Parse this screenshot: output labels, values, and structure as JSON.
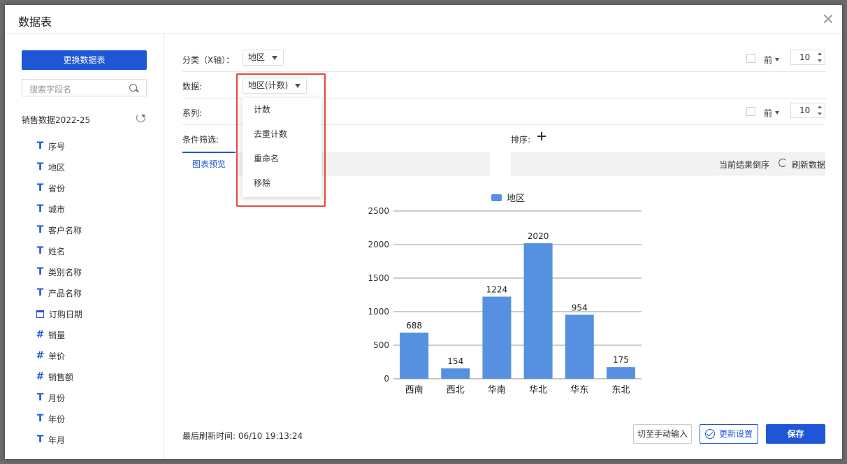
{
  "dialog": {
    "title": "数据表"
  },
  "sidebar": {
    "change_button": "更换数据表",
    "search_placeholder": "搜索字段名",
    "dataset_name": "销售数据2022-25",
    "fields": [
      {
        "type": "text",
        "icon": "text-type-icon",
        "label": "序号"
      },
      {
        "type": "text",
        "icon": "text-type-icon",
        "label": "地区"
      },
      {
        "type": "text",
        "icon": "text-type-icon",
        "label": "省份"
      },
      {
        "type": "text",
        "icon": "text-type-icon",
        "label": "城市"
      },
      {
        "type": "text",
        "icon": "text-type-icon",
        "label": "客户名称"
      },
      {
        "type": "text",
        "icon": "text-type-icon",
        "label": "姓名"
      },
      {
        "type": "text",
        "icon": "text-type-icon",
        "label": "类别名称"
      },
      {
        "type": "text",
        "icon": "text-type-icon",
        "label": "产品名称"
      },
      {
        "type": "date",
        "icon": "calendar-icon",
        "label": "订购日期"
      },
      {
        "type": "number",
        "icon": "hash-icon",
        "label": "销量"
      },
      {
        "type": "number",
        "icon": "hash-icon",
        "label": "单价"
      },
      {
        "type": "number",
        "icon": "hash-icon",
        "label": "销售额"
      },
      {
        "type": "text",
        "icon": "text-type-icon",
        "label": "月份"
      },
      {
        "type": "text",
        "icon": "text-type-icon",
        "label": "年份"
      },
      {
        "type": "text",
        "icon": "text-type-icon",
        "label": "年月"
      }
    ]
  },
  "config": {
    "category_label": "分类（X轴）：",
    "category_value": "地区",
    "data_label": "数据:",
    "data_value": "地区(计数)",
    "series_label": "系列:",
    "filter_label": "条件筛选:",
    "sort_label": "排序:",
    "top_label": "前",
    "top_value_1": "10",
    "top_value_2": "10"
  },
  "dropdown": {
    "items": [
      "计数",
      "去重计数",
      "重命名",
      "移除"
    ]
  },
  "tabs": {
    "active": "图表预览",
    "reverse": "当前结果倒序",
    "refresh": "刷新数据"
  },
  "chart_data": {
    "type": "bar",
    "categories": [
      "西南",
      "西北",
      "华南",
      "华北",
      "华东",
      "东北"
    ],
    "series": [
      {
        "name": "地区",
        "values": [
          688,
          154,
          1224,
          2020,
          954,
          175
        ]
      }
    ],
    "ylim": [
      0,
      2500
    ],
    "yticks": [
      0,
      500,
      1000,
      1500,
      2000,
      2500
    ],
    "color": "#5591e0",
    "legend": "top"
  },
  "footer": {
    "last_refresh": "最后刷新时间: 06/10 19:13:24",
    "manual_button": "切至手动输入",
    "update_button": "更新设置",
    "save_button": "保存"
  },
  "colors": {
    "primary": "#1e56d6",
    "highlight": "#e8473e",
    "bar": "#5591e0"
  }
}
